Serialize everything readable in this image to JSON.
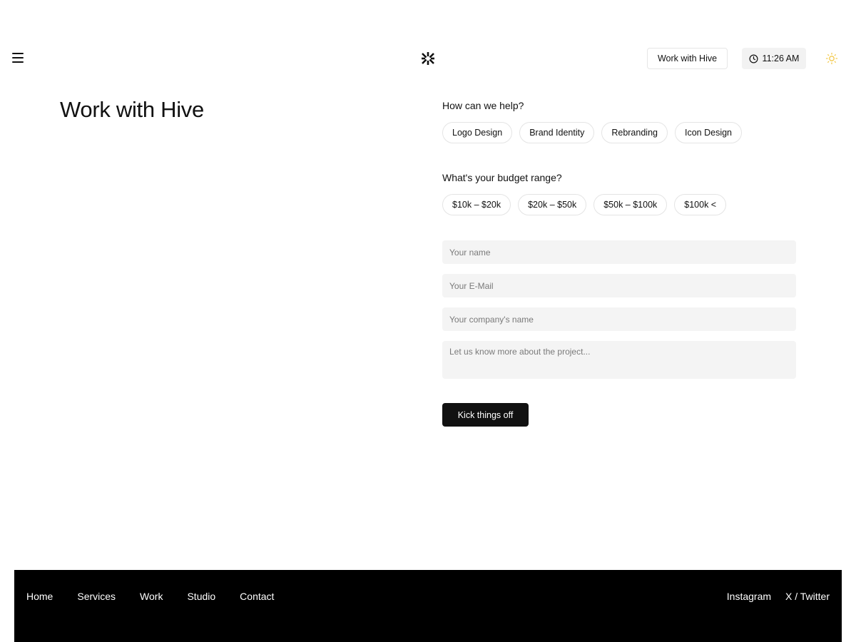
{
  "header": {
    "work_button_label": "Work with Hive",
    "time": "11:26 AM"
  },
  "main": {
    "title": "Work with Hive"
  },
  "form": {
    "help_question": "How can we help?",
    "services": [
      "Logo Design",
      "Brand Identity",
      "Rebranding",
      "Icon Design"
    ],
    "budget_question": "What's your budget range?",
    "budgets": [
      "$10k – $20k",
      "$20k – $50k",
      "$50k – $100k",
      "$100k <"
    ],
    "name_placeholder": "Your name",
    "email_placeholder": "Your E-Mail",
    "company_placeholder": "Your company's name",
    "project_placeholder": "Let us know more about the project...",
    "submit_label": "Kick things off"
  },
  "footer": {
    "nav": [
      "Home",
      "Services",
      "Work",
      "Studio",
      "Contact"
    ],
    "social": [
      "Instagram",
      "X / Twitter"
    ]
  },
  "colors": {
    "background": "#ffffff",
    "text": "#111111",
    "field_bg": "#f4f4f4",
    "footer_bg": "#000000",
    "sun_icon": "#f2c94c"
  }
}
